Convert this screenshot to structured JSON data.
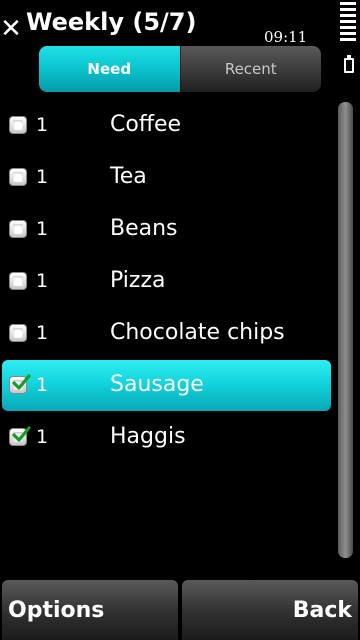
{
  "app": {
    "title": "Weekly (5/7)",
    "close_icon": "close-icon"
  },
  "status": {
    "time": "09:11",
    "signal_icon": "signal-strength-icon",
    "battery_icon": "battery-icon"
  },
  "tabs": [
    {
      "label": "Need",
      "active": true
    },
    {
      "label": "Recent",
      "active": false
    }
  ],
  "items": [
    {
      "qty": "1",
      "name": "Coffee",
      "checked": false,
      "selected": false
    },
    {
      "qty": "1",
      "name": "Tea",
      "checked": false,
      "selected": false
    },
    {
      "qty": "1",
      "name": "Beans",
      "checked": false,
      "selected": false
    },
    {
      "qty": "1",
      "name": "Pizza",
      "checked": false,
      "selected": false
    },
    {
      "qty": "1",
      "name": "Chocolate chips",
      "checked": false,
      "selected": false
    },
    {
      "qty": "1",
      "name": "Sausage",
      "checked": true,
      "selected": true
    },
    {
      "qty": "1",
      "name": "Haggis",
      "checked": true,
      "selected": false
    }
  ],
  "softkeys": {
    "left": "Options",
    "right": "Back"
  },
  "colors": {
    "accent": "#12d4dd",
    "background": "#000000",
    "checkmark": "#1a9a2a"
  }
}
